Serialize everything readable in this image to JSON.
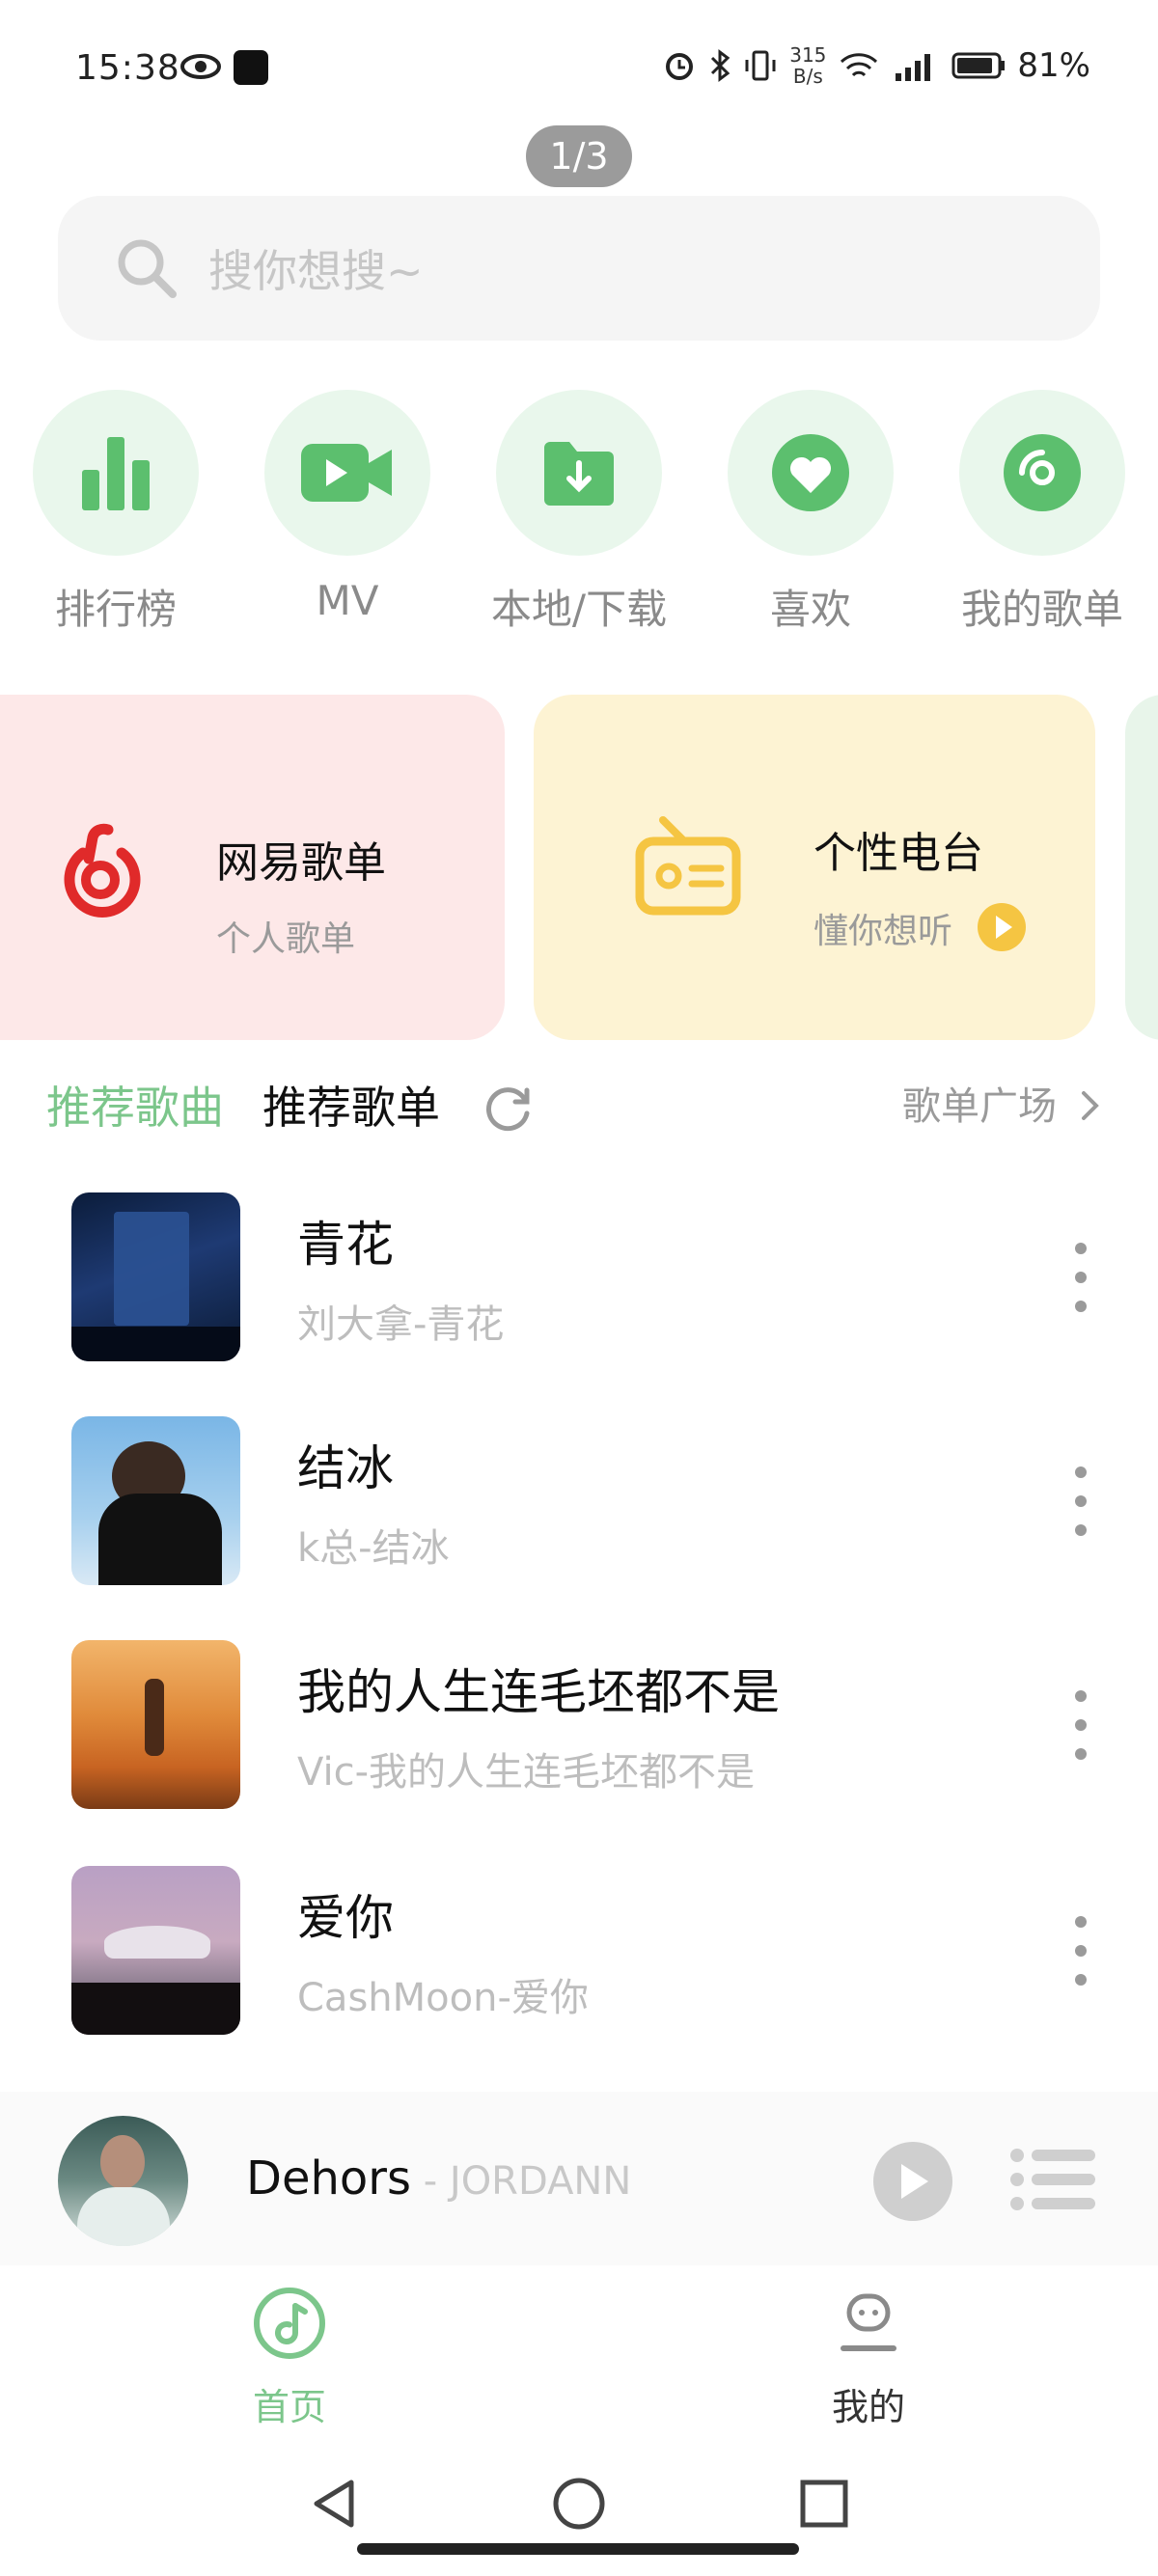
{
  "status": {
    "time": "15:38",
    "speed_value": "315",
    "speed_unit": "B/s",
    "battery": "81%"
  },
  "pager": "1/3",
  "search": {
    "placeholder": "搜你想搜~"
  },
  "quick": [
    {
      "label": "排行榜",
      "icon": "bar-chart-icon"
    },
    {
      "label": "MV",
      "icon": "video-camera-icon"
    },
    {
      "label": "本地/下载",
      "icon": "download-folder-icon"
    },
    {
      "label": "喜欢",
      "icon": "heart-icon"
    },
    {
      "label": "我的歌单",
      "icon": "disc-icon"
    }
  ],
  "cards": [
    {
      "title": "网易歌单",
      "subtitle": "个人歌单",
      "icon": "netease-logo"
    },
    {
      "title": "个性电台",
      "subtitle": "懂你想听",
      "icon": "radio-icon"
    }
  ],
  "tabs": {
    "recommended_songs": "推荐歌曲",
    "recommended_playlists": "推荐歌单",
    "plaza": "歌单广场"
  },
  "songs": [
    {
      "title": "青花",
      "subtitle": "刘大拿-青花"
    },
    {
      "title": "结冰",
      "subtitle": "k总-结冰"
    },
    {
      "title": "我的人生连毛坯都不是",
      "subtitle": "Vic-我的人生连毛坯都不是"
    },
    {
      "title": "爱你",
      "subtitle": "CashMoon-爱你"
    }
  ],
  "player": {
    "song": "Dehors",
    "artist": " - JORDANN"
  },
  "nav": {
    "home": "首页",
    "mine": "我的"
  },
  "colors": {
    "accent": "#7cc68b",
    "card_red": "#fde8e8",
    "card_yellow": "#fdf3d3",
    "netease_red": "#e02a2a",
    "radio_yellow": "#f5c542"
  }
}
